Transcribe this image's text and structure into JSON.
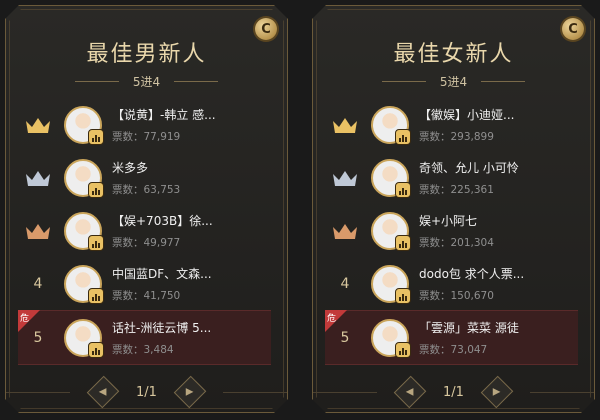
{
  "panels": [
    {
      "title": "最佳男新人",
      "subtitle": "5进4",
      "coin": "C",
      "page": "1/1",
      "rows": [
        {
          "rank": "crown-gold",
          "name": "【说黄】-韩立 感...",
          "votes": "票数：77,919"
        },
        {
          "rank": "crown-silver",
          "name": "米多多",
          "votes": "票数：63,753"
        },
        {
          "rank": "crown-bronze",
          "name": "【娱+703B】徐...",
          "votes": "票数：49,977"
        },
        {
          "rank": "4",
          "name": "中国蓝DF、文森...",
          "votes": "票数：41,750"
        },
        {
          "rank": "5",
          "name": "话社-洲徒云博 5...",
          "votes": "票数：3,484",
          "danger": "危"
        }
      ]
    },
    {
      "title": "最佳女新人",
      "subtitle": "5进4",
      "coin": "C",
      "page": "1/1",
      "rows": [
        {
          "rank": "crown-gold",
          "name": "【徽娱】小迪娅...",
          "votes": "票数：293,899"
        },
        {
          "rank": "crown-silver",
          "name": "奇领、允儿 小可怜",
          "votes": "票数：225,361"
        },
        {
          "rank": "crown-bronze",
          "name": "娱+小阿七",
          "votes": "票数：201,304"
        },
        {
          "rank": "4",
          "name": "dodo包 求个人票...",
          "votes": "票数：150,670"
        },
        {
          "rank": "5",
          "name": "「雲源」菜菜 源徒",
          "votes": "票数：73,047",
          "danger": "危"
        }
      ]
    }
  ],
  "colors": {
    "gold": "#e9c164",
    "silver": "#bfc8d6",
    "bronze": "#d99a6a",
    "danger": "#c23a3a"
  }
}
